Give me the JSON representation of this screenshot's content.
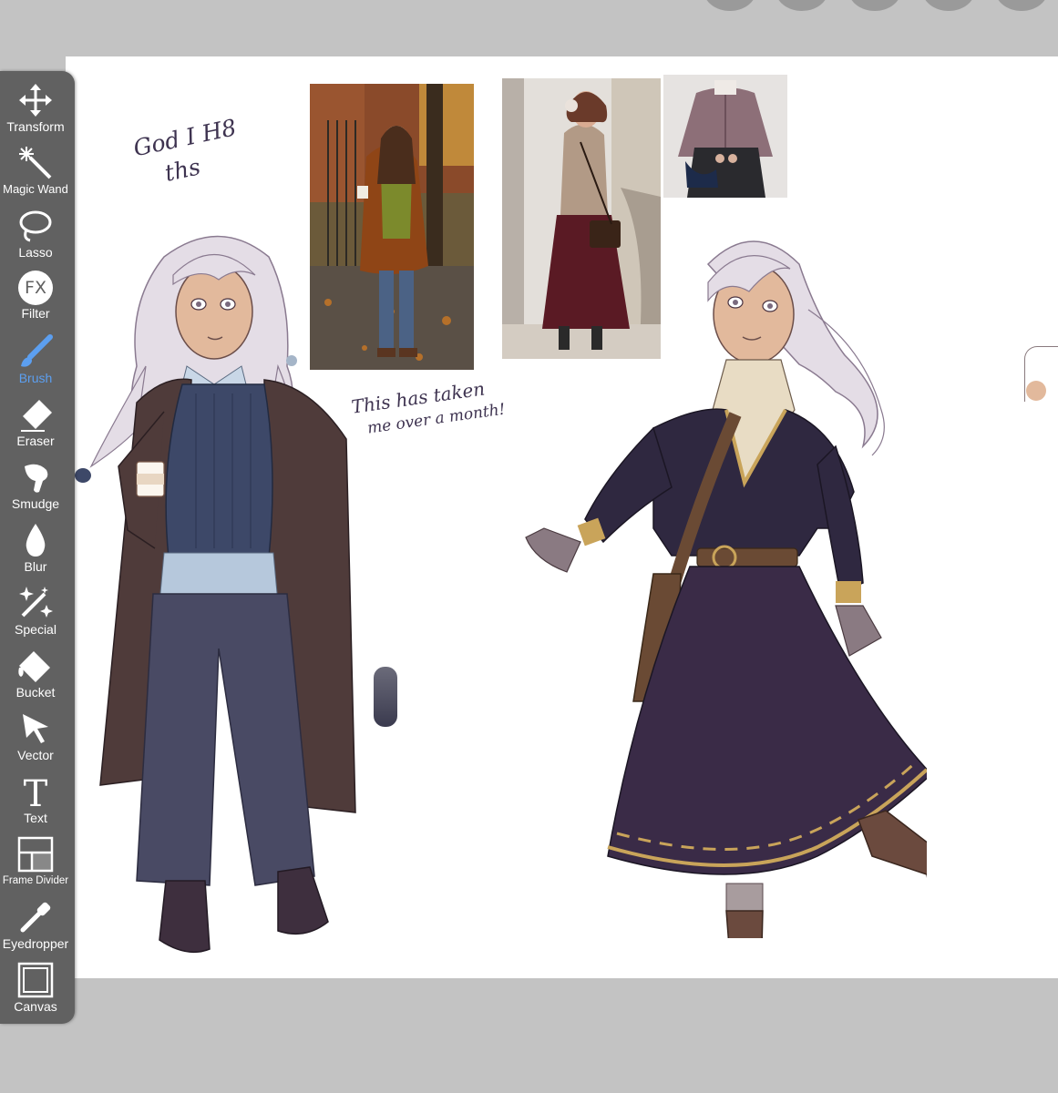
{
  "toolbar": {
    "active_tool": "Brush",
    "accent_color": "#5c9ff0",
    "tools": [
      {
        "label": "Transform",
        "icon": "transform-icon"
      },
      {
        "label": "Magic Wand",
        "icon": "magic-wand-icon"
      },
      {
        "label": "Lasso",
        "icon": "lasso-icon"
      },
      {
        "label": "Filter",
        "icon": "fx-filter-icon"
      },
      {
        "label": "Brush",
        "icon": "brush-icon"
      },
      {
        "label": "Eraser",
        "icon": "eraser-icon"
      },
      {
        "label": "Smudge",
        "icon": "smudge-icon"
      },
      {
        "label": "Blur",
        "icon": "blur-drop-icon"
      },
      {
        "label": "Special",
        "icon": "special-sparkle-icon"
      },
      {
        "label": "Bucket",
        "icon": "bucket-icon"
      },
      {
        "label": "Vector",
        "icon": "vector-arrow-icon"
      },
      {
        "label": "Text",
        "icon": "text-t-icon"
      },
      {
        "label": "Frame Divider",
        "icon": "frame-divider-icon"
      },
      {
        "label": "Eyedropper",
        "icon": "eyedropper-icon"
      },
      {
        "label": "Canvas",
        "icon": "canvas-icon"
      }
    ],
    "filter_icon_text": "FX"
  },
  "canvas": {
    "notes": {
      "note_1_line_1": "God I H8",
      "note_1_line_2": "ths",
      "note_2_line_1": "This has taken",
      "note_2_line_2": "me over a month!"
    }
  }
}
